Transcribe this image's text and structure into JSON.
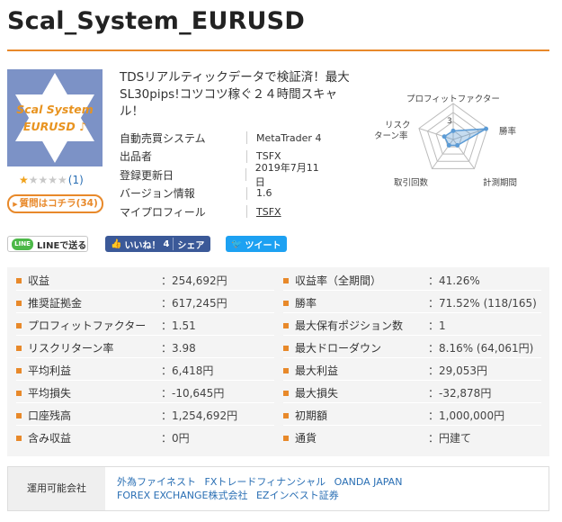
{
  "page": {
    "title": "Scal_System_EURUSD"
  },
  "thumbnail": {
    "line1": "Scal System",
    "line2": "EURUSD ♪"
  },
  "rating": {
    "stars": 1,
    "max_stars": 5,
    "count_label": "(1)"
  },
  "ask_button": {
    "label": "質問はコチラ(34)"
  },
  "description": "TDSリアルティックデータで検証済！最大SL30pips!コツコツ稼ぐ２４時間スキャル！",
  "info": [
    {
      "label": "自動売買システム",
      "value": "MetaTrader 4",
      "link": false
    },
    {
      "label": "出品者",
      "value": "TSFX",
      "link": false
    },
    {
      "label": "登録更新日",
      "value": "2019年7月11日",
      "link": false
    },
    {
      "label": "バージョン情報",
      "value": "1.6",
      "link": false
    },
    {
      "label": "マイプロフィール",
      "value": "TSFX",
      "link": true
    }
  ],
  "radar": {
    "labels": {
      "profit_factor": "プロフィットファクター",
      "win_rate": "勝率",
      "period": "計測期間",
      "trades": "取引回数",
      "risk_return_1": "リスク",
      "risk_return_2": "ターン率"
    },
    "tick": "3",
    "values": {
      "profit_factor": 1.2,
      "win_rate": 4.8,
      "period": 1.0,
      "trades": 1.0,
      "risk_return": 1.3
    },
    "max": 5,
    "accent": "#5b9bd5"
  },
  "share": {
    "line_label": "LINEで送る",
    "line_icon": "LINE",
    "like_label": "いいね！",
    "like_count": "4",
    "share_label": "シェア",
    "tweet_label": "ツイート"
  },
  "stats": {
    "left": [
      {
        "label": "収益",
        "value": "：254,692円"
      },
      {
        "label": "推奨証拠金",
        "value": "：617,245円"
      },
      {
        "label": "プロフィットファクター",
        "value": "：1.51"
      },
      {
        "label": "リスクリターン率",
        "value": "：3.98"
      },
      {
        "label": "平均利益",
        "value": "：6,418円"
      },
      {
        "label": "平均損失",
        "value": "：-10,645円"
      },
      {
        "label": "口座残高",
        "value": "：1,254,692円"
      },
      {
        "label": "含み収益",
        "value": "：0円"
      }
    ],
    "right": [
      {
        "label": "収益率（全期間）",
        "value": "：41.26%"
      },
      {
        "label": "勝率",
        "value": "：71.52% (118/165)"
      },
      {
        "label": "最大保有ポジション数",
        "value": "：1"
      },
      {
        "label": "最大ドローダウン",
        "value": "：8.16% (64,061円)"
      },
      {
        "label": "最大利益",
        "value": "：29,053円"
      },
      {
        "label": "最大損失",
        "value": "：-32,878円"
      },
      {
        "label": "初期額",
        "value": "：1,000,000円"
      },
      {
        "label": "通貨",
        "value": "：円建て"
      }
    ]
  },
  "companies": {
    "label": "運用可能会社",
    "items": [
      "外為ファイネスト",
      "FXトレードフィナンシャル",
      "OANDA JAPAN",
      "FOREX EXCHANGE株式会社",
      "EZインベスト証券"
    ]
  },
  "colors": {
    "accent": "#e8892a",
    "link": "#2a6fb4",
    "thumb_bg": "#7c92c6"
  }
}
